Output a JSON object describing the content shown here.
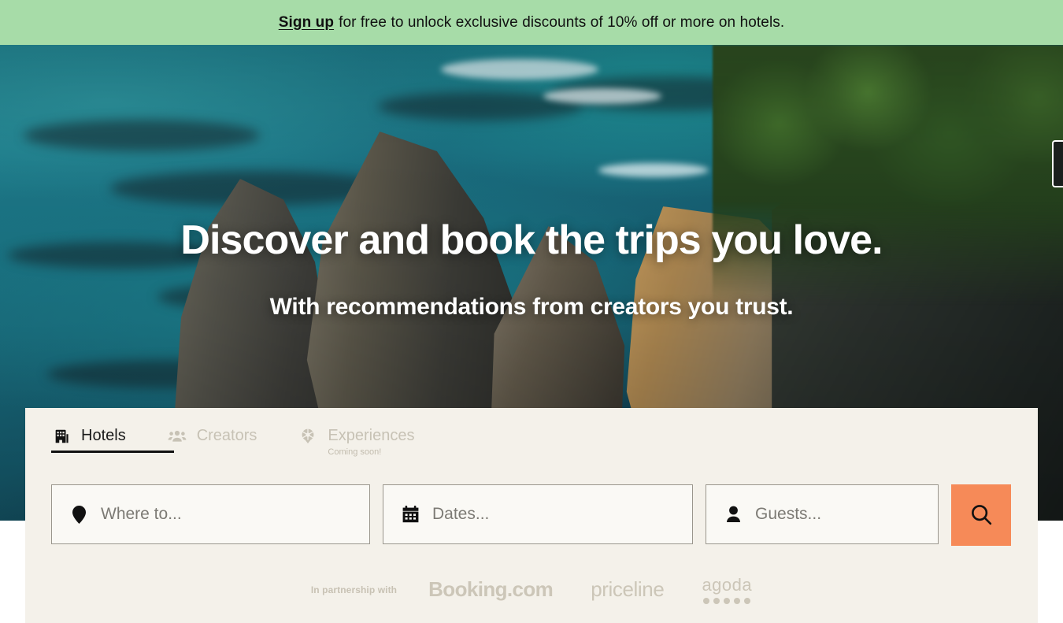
{
  "promo": {
    "signup_link": "Sign up",
    "message": "for free to unlock exclusive discounts of 10% off or more on hotels.",
    "background_color": "#a7dca8"
  },
  "hero": {
    "title": "Discover and book the trips you love.",
    "subtitle": "With recommendations from creators you trust.",
    "image_description": "Aerial view of rocky coastline with turquoise ocean water, sea stacks, tan cliffs and pine trees"
  },
  "search": {
    "tabs": [
      {
        "label": "Hotels",
        "icon": "hotel-building-icon",
        "active": true,
        "sublabel": ""
      },
      {
        "label": "Creators",
        "icon": "people-group-icon",
        "active": false,
        "sublabel": ""
      },
      {
        "label": "Experiences",
        "icon": "ferris-wheel-icon",
        "active": false,
        "sublabel": "Coming soon!"
      }
    ],
    "fields": [
      {
        "name": "where",
        "icon": "location-pin-icon",
        "placeholder": "Where to...",
        "value": ""
      },
      {
        "name": "dates",
        "icon": "calendar-icon",
        "placeholder": "Dates...",
        "value": ""
      },
      {
        "name": "guests",
        "icon": "person-icon",
        "placeholder": "Guests...",
        "value": ""
      }
    ],
    "search_button": {
      "icon": "search-icon",
      "color": "#f68a58"
    },
    "panel_background": "#f4f1ea"
  },
  "partners": {
    "prefix": "In partnership with",
    "logos": [
      {
        "name": "Booking.com"
      },
      {
        "name": "priceline"
      },
      {
        "name": "agoda"
      }
    ]
  }
}
